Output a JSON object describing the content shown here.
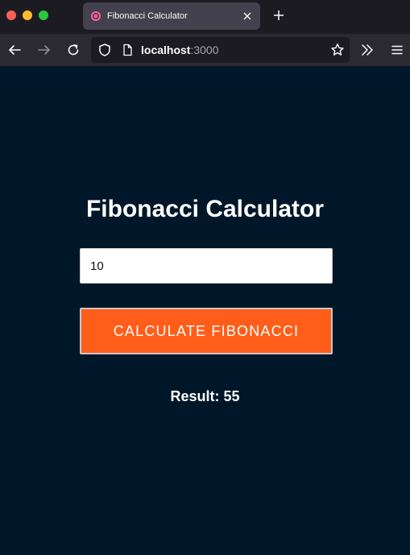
{
  "browser": {
    "tab": {
      "title": "Fibonacci Calculator"
    },
    "url": {
      "host": "localhost",
      "port": ":3000"
    },
    "icons": {
      "favicon": "target-favicon-icon",
      "tab_close": "close-icon",
      "new_tab": "plus-icon",
      "back": "arrow-left-icon",
      "forward": "arrow-right-icon",
      "reload": "reload-icon",
      "shield": "shield-icon",
      "page": "page-icon",
      "bookmark": "star-icon",
      "more_tools": "chevrons-right-icon",
      "menu": "hamburger-menu-icon"
    }
  },
  "page": {
    "heading": "Fibonacci Calculator",
    "input": {
      "value": "10"
    },
    "button_label": "CALCULATE FIBONACCI",
    "result_text": "Result: 55"
  },
  "colors": {
    "page_background": "#001629",
    "button_background": "#ff5e1a",
    "text": "#ffffff"
  }
}
